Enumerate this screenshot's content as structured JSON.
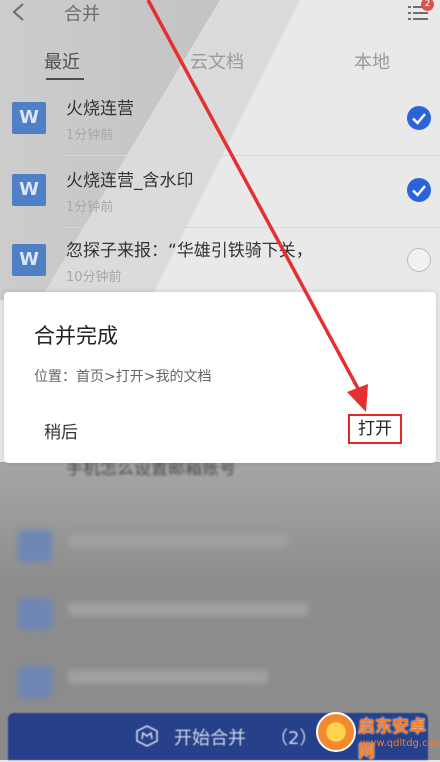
{
  "header": {
    "title": "合并",
    "menu_badge": "2"
  },
  "tabs": [
    {
      "label": "最近"
    },
    {
      "label": "云文档"
    },
    {
      "label": "本地"
    }
  ],
  "files": [
    {
      "name": "火烧连营",
      "time": "1分钟前",
      "checked": true,
      "icon_letter": "W"
    },
    {
      "name": "火烧连营_含水印",
      "time": "1分钟前",
      "checked": true,
      "icon_letter": "W"
    },
    {
      "name": "忽探子来报：“华雄引铁骑下关，",
      "time": "10分钟前",
      "checked": false,
      "icon_letter": "W"
    }
  ],
  "partial_row_text": "手机怎么设置邮箱账号",
  "dialog": {
    "title": "合并完成",
    "location": "位置：首页>打开>我的文档",
    "later_label": "稍后",
    "open_label": "打开"
  },
  "merge_button": {
    "label": "开始合并",
    "count": "（2）"
  },
  "watermark": {
    "title": "启东安卓网",
    "url": "www.qdltdg.com"
  },
  "colors": {
    "accent": "#2b64d8",
    "annotation": "#e02a2a",
    "merge_bar": "#26408a"
  }
}
